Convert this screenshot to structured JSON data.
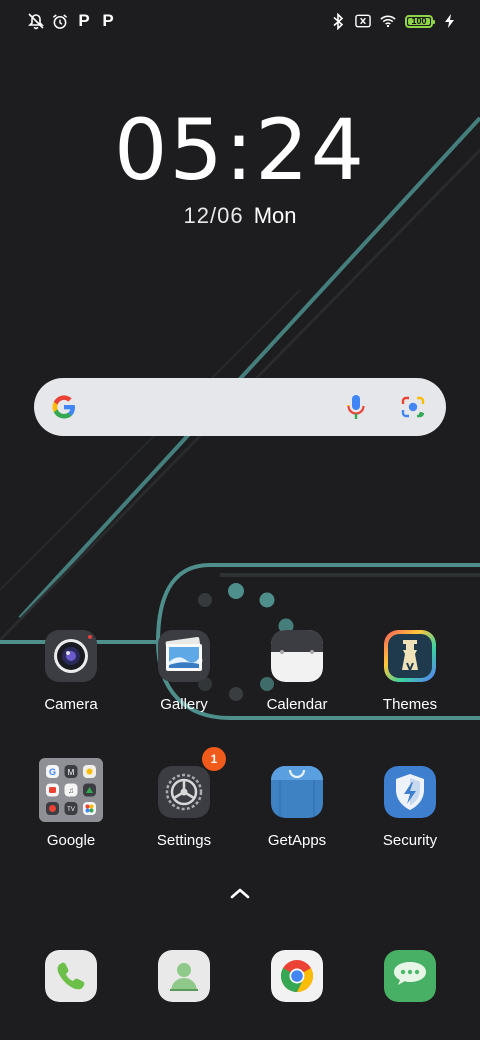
{
  "status_bar": {
    "left_icons": [
      "bell-off-icon",
      "alarm-icon",
      "p-icon",
      "p-icon"
    ],
    "p1": "P",
    "p2": "P",
    "right_icons": [
      "bluetooth-icon",
      "no-sim-icon",
      "wifi-icon",
      "battery-icon",
      "charging-icon"
    ],
    "battery_level": "100"
  },
  "clock": {
    "hh": "05",
    "sep": ":",
    "mm": "24",
    "date": "12/06",
    "weekday": "Mon"
  },
  "search": {
    "icons": [
      "google-g-icon",
      "mic-icon",
      "lens-icon"
    ]
  },
  "apps": [
    {
      "label": "Camera",
      "icon": "camera-icon"
    },
    {
      "label": "Gallery",
      "icon": "gallery-icon"
    },
    {
      "label": "Calendar",
      "icon": "calendar-icon"
    },
    {
      "label": "Themes",
      "icon": "themes-icon"
    },
    {
      "label": "Google",
      "icon": "google-folder-icon"
    },
    {
      "label": "Settings",
      "icon": "settings-icon",
      "badge": "1"
    },
    {
      "label": "GetApps",
      "icon": "getapps-icon"
    },
    {
      "label": "Security",
      "icon": "security-icon"
    }
  ],
  "dock": [
    {
      "icon": "phone-icon"
    },
    {
      "icon": "contacts-icon"
    },
    {
      "icon": "chrome-icon"
    },
    {
      "icon": "messages-icon"
    }
  ],
  "colors": {
    "background": "#1d1d1f",
    "wallpaper_line": "#4e8f8c",
    "badge": "#f05a1a",
    "battery": "#8fd448"
  }
}
